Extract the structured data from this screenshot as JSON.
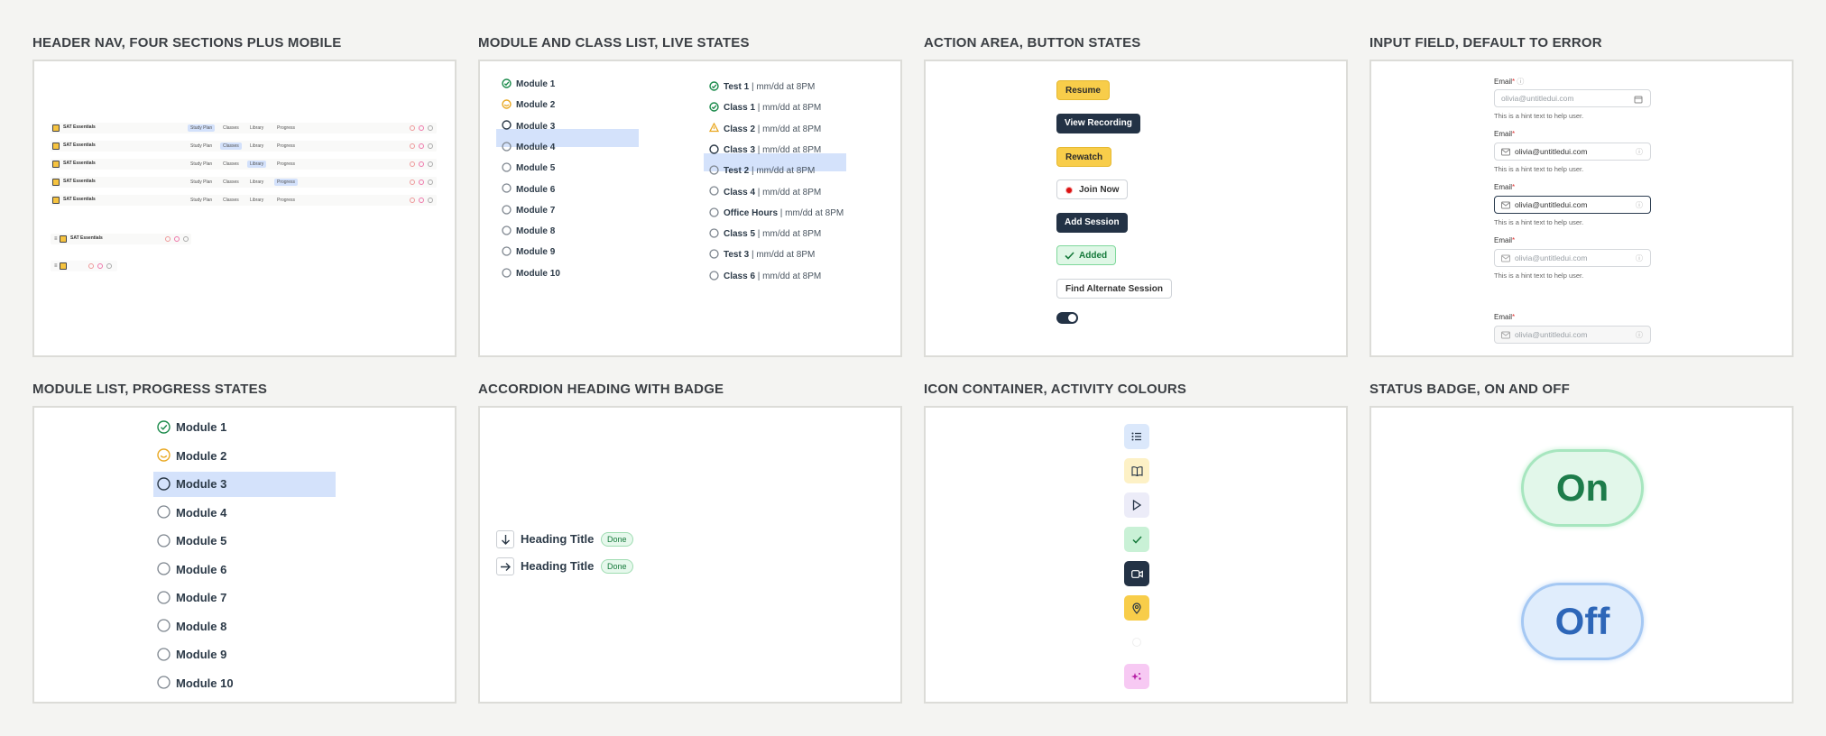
{
  "sections": {
    "header_nav": "HEADER NAV, FOUR SECTIONS PLUS MOBILE",
    "module_class": "MODULE AND CLASS LIST, LIVE STATES",
    "action_area": "ACTION AREA, BUTTON STATES",
    "input_field": "INPUT FIELD, DEFAULT TO ERROR",
    "module_progress": "MODULE LIST, PROGRESS STATES",
    "accordion": "ACCORDION HEADING WITH BADGE",
    "icon_container": "ICON CONTAINER, ACTIVITY COLOURS",
    "status_badge": "STATUS BADGE, ON AND OFF"
  },
  "header_nav": {
    "brand": "SAT Essentials",
    "items": [
      "Study Plan",
      "Classes",
      "Library",
      "Progress"
    ]
  },
  "modules": [
    {
      "label": "Module 1",
      "state": "done"
    },
    {
      "label": "Module 2",
      "state": "progress"
    },
    {
      "label": "Module 3",
      "state": "selected"
    },
    {
      "label": "Module 4",
      "state": "todo"
    },
    {
      "label": "Module 5",
      "state": "todo"
    },
    {
      "label": "Module 6",
      "state": "todo"
    },
    {
      "label": "Module 7",
      "state": "todo"
    },
    {
      "label": "Module 8",
      "state": "todo"
    },
    {
      "label": "Module 9",
      "state": "todo"
    },
    {
      "label": "Module 10",
      "state": "todo"
    }
  ],
  "classes": [
    {
      "name": "Test 1",
      "time": " | mm/dd at 8PM",
      "state": "done"
    },
    {
      "name": "Class 1",
      "time": " | mm/dd at 8PM",
      "state": "done"
    },
    {
      "name": "Class 2",
      "time": " | mm/dd at 8PM",
      "state": "warning"
    },
    {
      "name": "Class 3",
      "time": " | mm/dd at 8PM",
      "state": "selected"
    },
    {
      "name": "Test 2",
      "time": " | mm/dd at 8PM",
      "state": "todo"
    },
    {
      "name": "Class 4",
      "time": " | mm/dd at 8PM",
      "state": "todo"
    },
    {
      "name": "Office Hours",
      "time": " | mm/dd at 8PM",
      "state": "todo"
    },
    {
      "name": "Class 5",
      "time": " | mm/dd at 8PM",
      "state": "todo"
    },
    {
      "name": "Test 3",
      "time": " | mm/dd at 8PM",
      "state": "todo"
    },
    {
      "name": "Class 6",
      "time": " | mm/dd at 8PM",
      "state": "todo"
    }
  ],
  "buttons": {
    "resume": "Resume",
    "view_recording": "View Recording",
    "rewatch": "Rewatch",
    "join_now": "Join Now",
    "add_session": "Add Session",
    "added": "Added",
    "find_alternate": "Find Alternate Session"
  },
  "inputs": {
    "label": "Email",
    "required_mark": "*",
    "placeholder": "olivia@untitledui.com",
    "value": "olivia@untitledui.com",
    "hint": "This is a hint text to help user."
  },
  "accordion": {
    "title": "Heading Title",
    "badge": "Done"
  },
  "icon_colors": {
    "list": "#dbe8fb",
    "book": "#fdf1c6",
    "play": "#ececf8",
    "check": "#c9f1d6",
    "video": "#233245",
    "location": "#f8cd4a",
    "sparkle": "#f7c9f3"
  },
  "status": {
    "on": "On",
    "off": "Off"
  }
}
